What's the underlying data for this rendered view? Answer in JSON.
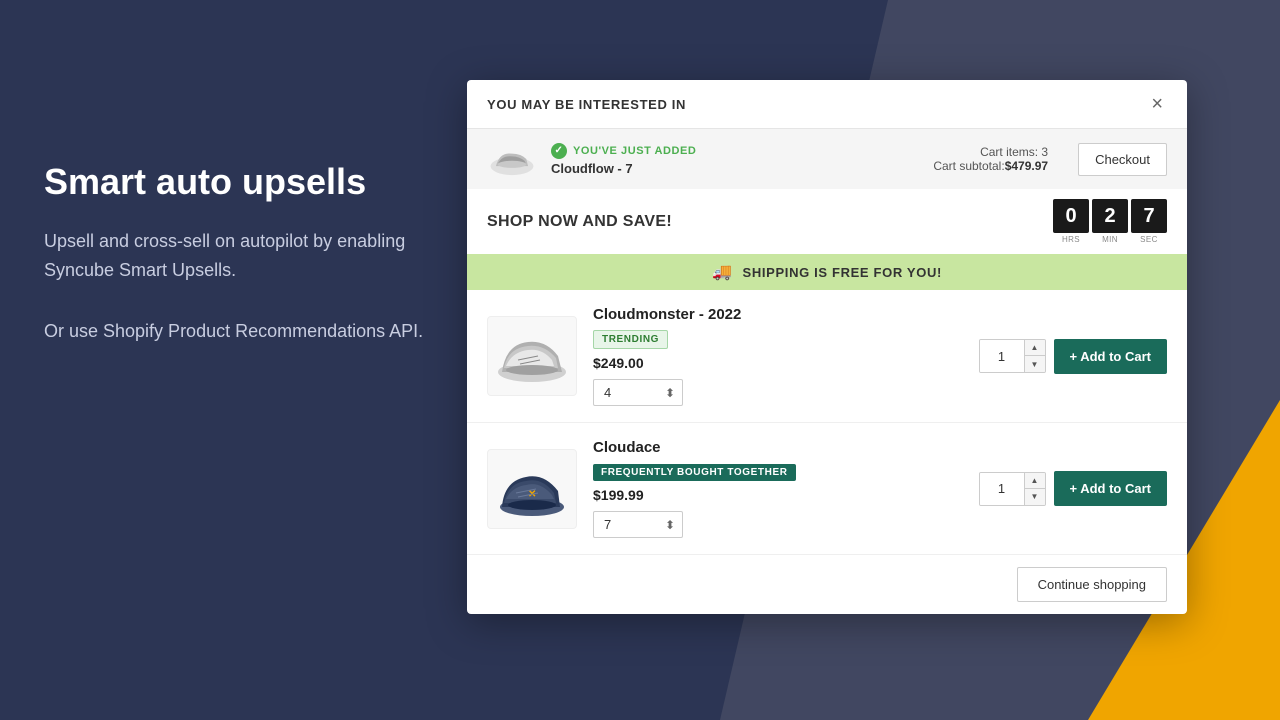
{
  "background": {
    "main_color": "#2c3554",
    "accent_color": "#f0a500"
  },
  "left_panel": {
    "heading": "Smart auto upsells",
    "paragraph1": "Upsell and cross-sell on autopilot by enabling Syncube Smart Upsells.",
    "paragraph2": "Or use Shopify Product Recommendations API."
  },
  "modal": {
    "title": "YOU MAY BE INTERESTED IN",
    "close_label": "×",
    "cart_bar": {
      "added_label": "YOU'VE JUST ADDED",
      "product_name": "Cloudflow - 7",
      "cart_items": "Cart items: 3",
      "cart_subtotal_label": "Cart subtotal:",
      "cart_subtotal_value": "$479.97",
      "checkout_label": "Checkout"
    },
    "timer_bar": {
      "shop_now_text": "SHOP NOW AND SAVE!",
      "hours": "0",
      "minutes": "2",
      "seconds": "7",
      "hrs_label": "HRS",
      "min_label": "MIN",
      "sec_label": "SEC"
    },
    "shipping_banner": "SHIPPING IS FREE FOR YOU!",
    "products": [
      {
        "name": "Cloudmonster - 2022",
        "badge": "TRENDING",
        "badge_type": "trending",
        "price": "$249.00",
        "size_value": "4",
        "qty": "1",
        "add_to_cart_label": "+ Add to Cart"
      },
      {
        "name": "Cloudace",
        "badge": "FREQUENTLY BOUGHT TOGETHER",
        "badge_type": "fbt",
        "price": "$199.99",
        "size_value": "7",
        "qty": "1",
        "add_to_cart_label": "+ Add to Cart"
      }
    ],
    "footer": {
      "continue_shopping_label": "Continue shopping"
    }
  }
}
